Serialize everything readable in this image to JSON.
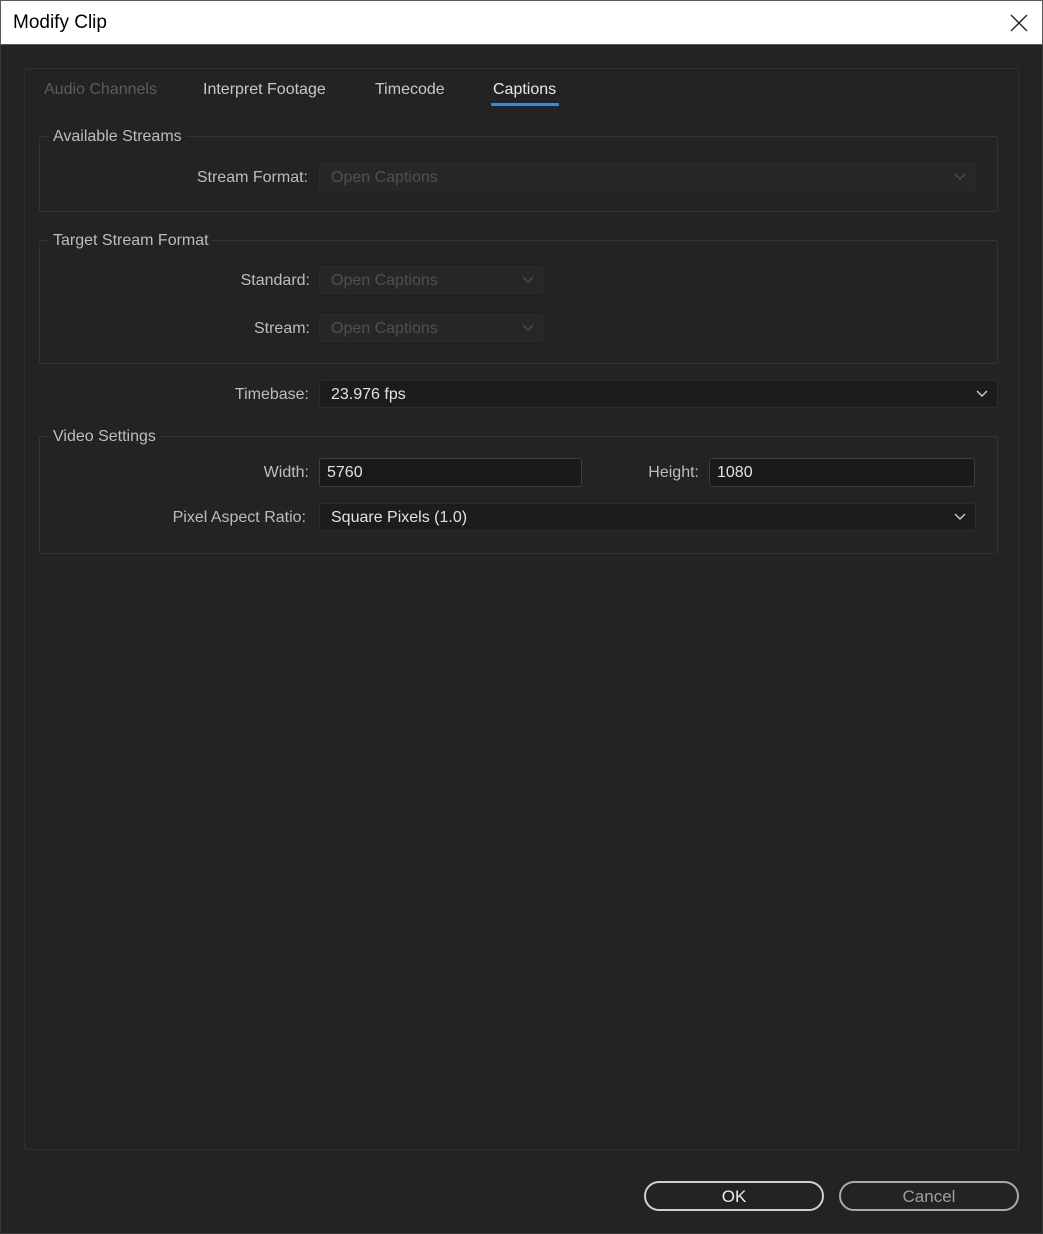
{
  "window": {
    "title": "Modify Clip",
    "close_icon": "close-icon"
  },
  "tabs": [
    {
      "label": "Audio Channels",
      "state": "disabled"
    },
    {
      "label": "Interpret Footage",
      "state": "normal"
    },
    {
      "label": "Timecode",
      "state": "normal"
    },
    {
      "label": "Captions",
      "state": "active"
    }
  ],
  "available_streams": {
    "title": "Available Streams",
    "stream_format_label": "Stream Format:",
    "stream_format_value": "Open Captions"
  },
  "target_stream_format": {
    "title": "Target Stream Format",
    "standard_label": "Standard:",
    "standard_value": "Open Captions",
    "stream_label": "Stream:",
    "stream_value": "Open Captions"
  },
  "timebase": {
    "label": "Timebase:",
    "value": "23.976 fps"
  },
  "video_settings": {
    "title": "Video Settings",
    "width_label": "Width:",
    "width_value": "5760",
    "height_label": "Height:",
    "height_value": "1080",
    "par_label": "Pixel Aspect Ratio:",
    "par_value": "Square Pixels (1.0)"
  },
  "buttons": {
    "ok": "OK",
    "cancel": "Cancel"
  },
  "colors": {
    "background": "#232323",
    "accent": "#3c8ad8",
    "text": "#bdbdbd"
  }
}
